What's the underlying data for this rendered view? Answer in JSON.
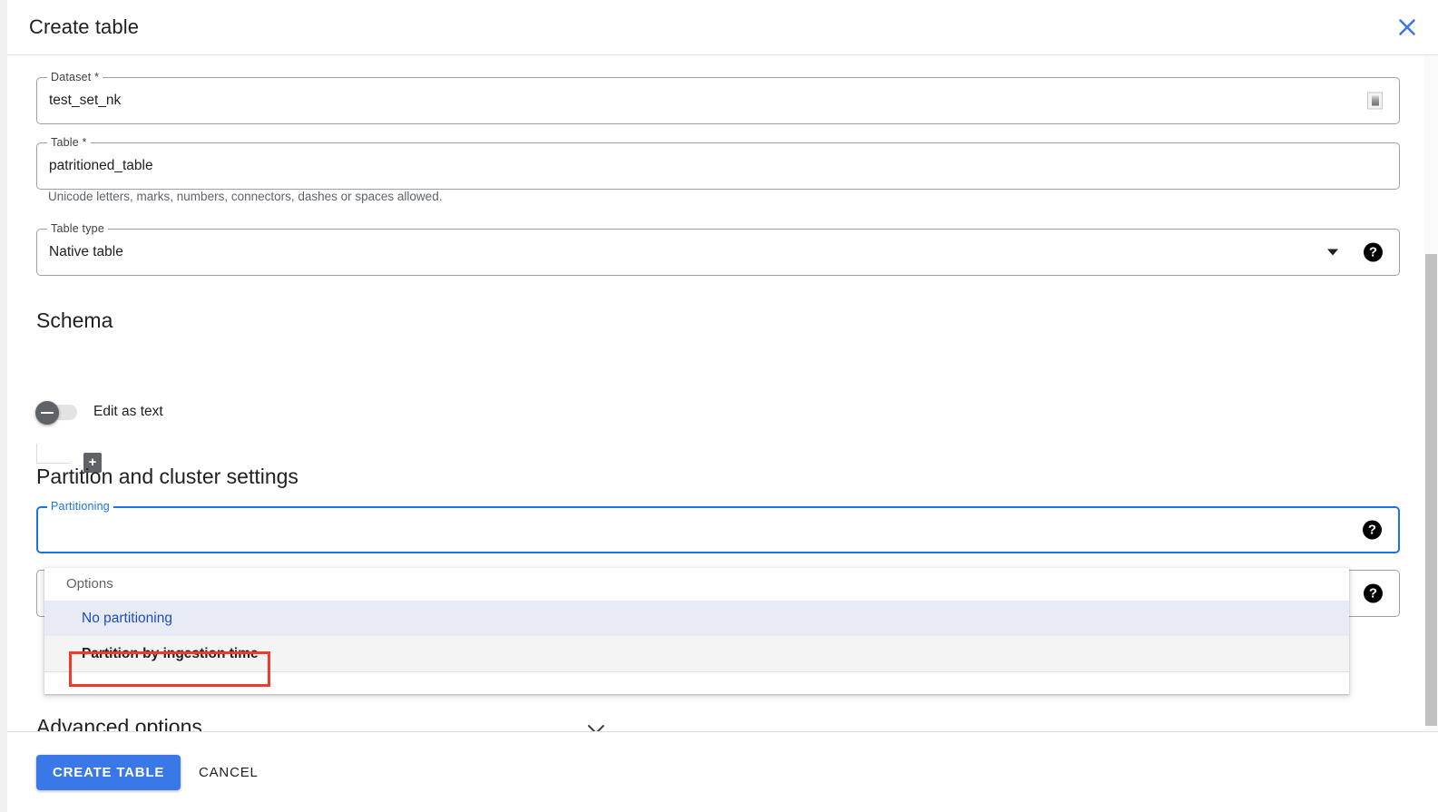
{
  "dialog": {
    "title": "Create table",
    "close_icon": "close-icon"
  },
  "fields": {
    "dataset": {
      "label": "Dataset *",
      "value": "test_set_nk",
      "trailing_icon": "broken-image-icon"
    },
    "table": {
      "label": "Table *",
      "value": "patritioned_table",
      "helper": "Unicode letters, marks, numbers, connectors, dashes or spaces allowed."
    },
    "table_type": {
      "label": "Table type",
      "value": "Native table",
      "caret_icon": "chevron-down-icon",
      "help_icon": "help-icon"
    }
  },
  "schema": {
    "heading": "Schema",
    "toggle_label": "Edit as text",
    "toggle_state": "off",
    "add_field_label": "+"
  },
  "partition": {
    "heading": "Partition and cluster settings",
    "partitioning_label": "Partitioning",
    "partitioning_value": "",
    "help_icon": "help-icon",
    "second_field_help_icon": "help-icon"
  },
  "dropdown": {
    "header": "Options",
    "items": [
      {
        "label": "No partitioning",
        "state": "selected"
      },
      {
        "label": "Partition by ingestion time",
        "state": "hovered"
      }
    ]
  },
  "advanced": {
    "label": "Advanced options",
    "chevron_icon": "chevron-down-icon"
  },
  "footer": {
    "create_label": "CREATE TABLE",
    "cancel_label": "CANCEL"
  },
  "colors": {
    "accent": "#1a73e8",
    "primary_button": "#3b78e7",
    "highlight_box": "#ef3b2c",
    "selected_row_bg": "#e8eaf6"
  }
}
